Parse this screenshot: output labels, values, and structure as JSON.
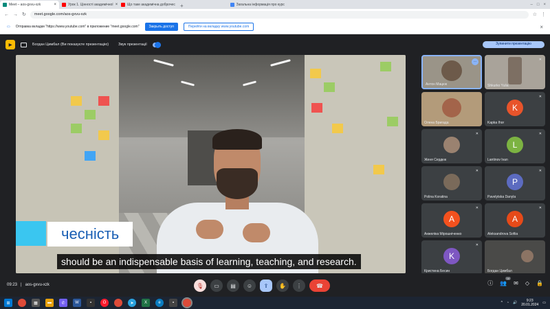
{
  "browser": {
    "tabs": [
      {
        "label": "Meet – aos-gxvu-xzk",
        "color": "#00897b",
        "active": true
      },
      {
        "label": "Урок 1. Цінності академічної",
        "color": "#ff0000",
        "active": false
      },
      {
        "label": "Що таке академічна доброчес",
        "color": "#ff0000",
        "active": false
      }
    ],
    "right_tab": "Загальна інформація про курс",
    "address": "meet.google.com/aos-gxvu-xzk",
    "notice": {
      "text": "Отправка вкладки \"https://www.youtube.com\" в приложение \"meet.google.com\"",
      "share_button": "Закрыть доступ",
      "switch_button": "Перейти на вкладку www.youtube.com"
    }
  },
  "meet": {
    "presenter_label": "Богдан Цимбал (Ви показуєте презентацію)",
    "audio_label": "Звук презентації",
    "stop_button": "Зупинити презентацію",
    "caption_word": "чесність",
    "subtitle": "should be an indispensable basis of learning, teaching, and research.",
    "time": "09:23",
    "meeting_code": "aos-gxvu-xzk",
    "participants_count": "16"
  },
  "participants": [
    {
      "name": "Антон Мацюк",
      "type": "video"
    },
    {
      "name": "Shkurko Yulia",
      "type": "video"
    },
    {
      "name": "Олена Бригада",
      "type": "video"
    },
    {
      "name": "Kapka Ihor",
      "type": "avatar",
      "letter": "K",
      "color": "#e8542b"
    },
    {
      "name": "Женя Сердюк",
      "type": "photo"
    },
    {
      "name": "Lantinov Ivan",
      "type": "avatar",
      "letter": "L",
      "color": "#7cb342"
    },
    {
      "name": "Polina Koratina",
      "type": "photo"
    },
    {
      "name": "Pavelytska Danyla",
      "type": "avatar",
      "letter": "P",
      "color": "#5c6bc0"
    },
    {
      "name": "Анжеліка Мірошніченко",
      "type": "avatar",
      "letter": "A",
      "color": "#f4511e"
    },
    {
      "name": "Aleksandrova Sofiia",
      "type": "avatar",
      "letter": "A",
      "color": "#e64a19"
    },
    {
      "name": "Кристина Бесин",
      "type": "avatar",
      "letter": "K",
      "color": "#7e57c2"
    },
    {
      "name": "Богдан Цимбал",
      "type": "video"
    }
  ],
  "taskbar": {
    "time": "9:23",
    "date": "20.01.2024"
  }
}
